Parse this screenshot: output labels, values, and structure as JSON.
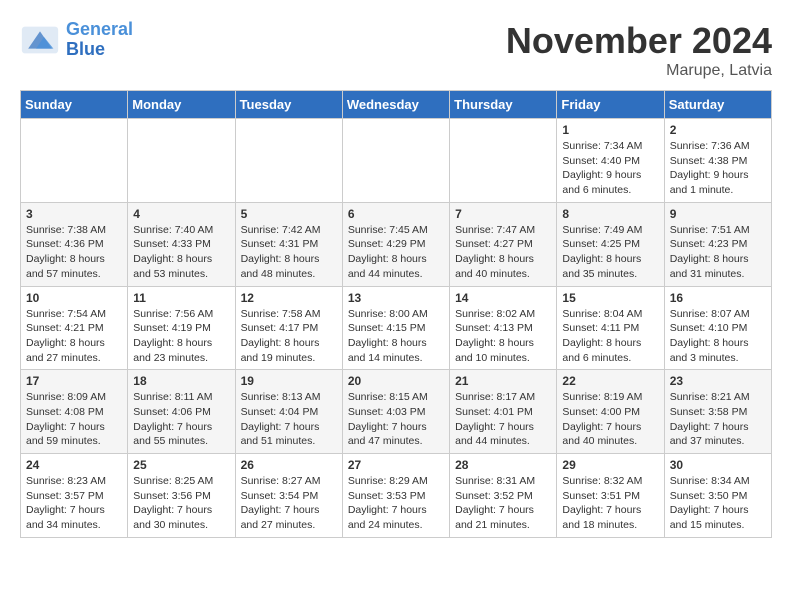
{
  "header": {
    "logo_line1": "General",
    "logo_line2": "Blue",
    "month": "November 2024",
    "location": "Marupe, Latvia"
  },
  "weekdays": [
    "Sunday",
    "Monday",
    "Tuesday",
    "Wednesday",
    "Thursday",
    "Friday",
    "Saturday"
  ],
  "weeks": [
    [
      {
        "day": "",
        "info": ""
      },
      {
        "day": "",
        "info": ""
      },
      {
        "day": "",
        "info": ""
      },
      {
        "day": "",
        "info": ""
      },
      {
        "day": "",
        "info": ""
      },
      {
        "day": "1",
        "info": "Sunrise: 7:34 AM\nSunset: 4:40 PM\nDaylight: 9 hours and 6 minutes."
      },
      {
        "day": "2",
        "info": "Sunrise: 7:36 AM\nSunset: 4:38 PM\nDaylight: 9 hours and 1 minute."
      }
    ],
    [
      {
        "day": "3",
        "info": "Sunrise: 7:38 AM\nSunset: 4:36 PM\nDaylight: 8 hours and 57 minutes."
      },
      {
        "day": "4",
        "info": "Sunrise: 7:40 AM\nSunset: 4:33 PM\nDaylight: 8 hours and 53 minutes."
      },
      {
        "day": "5",
        "info": "Sunrise: 7:42 AM\nSunset: 4:31 PM\nDaylight: 8 hours and 48 minutes."
      },
      {
        "day": "6",
        "info": "Sunrise: 7:45 AM\nSunset: 4:29 PM\nDaylight: 8 hours and 44 minutes."
      },
      {
        "day": "7",
        "info": "Sunrise: 7:47 AM\nSunset: 4:27 PM\nDaylight: 8 hours and 40 minutes."
      },
      {
        "day": "8",
        "info": "Sunrise: 7:49 AM\nSunset: 4:25 PM\nDaylight: 8 hours and 35 minutes."
      },
      {
        "day": "9",
        "info": "Sunrise: 7:51 AM\nSunset: 4:23 PM\nDaylight: 8 hours and 31 minutes."
      }
    ],
    [
      {
        "day": "10",
        "info": "Sunrise: 7:54 AM\nSunset: 4:21 PM\nDaylight: 8 hours and 27 minutes."
      },
      {
        "day": "11",
        "info": "Sunrise: 7:56 AM\nSunset: 4:19 PM\nDaylight: 8 hours and 23 minutes."
      },
      {
        "day": "12",
        "info": "Sunrise: 7:58 AM\nSunset: 4:17 PM\nDaylight: 8 hours and 19 minutes."
      },
      {
        "day": "13",
        "info": "Sunrise: 8:00 AM\nSunset: 4:15 PM\nDaylight: 8 hours and 14 minutes."
      },
      {
        "day": "14",
        "info": "Sunrise: 8:02 AM\nSunset: 4:13 PM\nDaylight: 8 hours and 10 minutes."
      },
      {
        "day": "15",
        "info": "Sunrise: 8:04 AM\nSunset: 4:11 PM\nDaylight: 8 hours and 6 minutes."
      },
      {
        "day": "16",
        "info": "Sunrise: 8:07 AM\nSunset: 4:10 PM\nDaylight: 8 hours and 3 minutes."
      }
    ],
    [
      {
        "day": "17",
        "info": "Sunrise: 8:09 AM\nSunset: 4:08 PM\nDaylight: 7 hours and 59 minutes."
      },
      {
        "day": "18",
        "info": "Sunrise: 8:11 AM\nSunset: 4:06 PM\nDaylight: 7 hours and 55 minutes."
      },
      {
        "day": "19",
        "info": "Sunrise: 8:13 AM\nSunset: 4:04 PM\nDaylight: 7 hours and 51 minutes."
      },
      {
        "day": "20",
        "info": "Sunrise: 8:15 AM\nSunset: 4:03 PM\nDaylight: 7 hours and 47 minutes."
      },
      {
        "day": "21",
        "info": "Sunrise: 8:17 AM\nSunset: 4:01 PM\nDaylight: 7 hours and 44 minutes."
      },
      {
        "day": "22",
        "info": "Sunrise: 8:19 AM\nSunset: 4:00 PM\nDaylight: 7 hours and 40 minutes."
      },
      {
        "day": "23",
        "info": "Sunrise: 8:21 AM\nSunset: 3:58 PM\nDaylight: 7 hours and 37 minutes."
      }
    ],
    [
      {
        "day": "24",
        "info": "Sunrise: 8:23 AM\nSunset: 3:57 PM\nDaylight: 7 hours and 34 minutes."
      },
      {
        "day": "25",
        "info": "Sunrise: 8:25 AM\nSunset: 3:56 PM\nDaylight: 7 hours and 30 minutes."
      },
      {
        "day": "26",
        "info": "Sunrise: 8:27 AM\nSunset: 3:54 PM\nDaylight: 7 hours and 27 minutes."
      },
      {
        "day": "27",
        "info": "Sunrise: 8:29 AM\nSunset: 3:53 PM\nDaylight: 7 hours and 24 minutes."
      },
      {
        "day": "28",
        "info": "Sunrise: 8:31 AM\nSunset: 3:52 PM\nDaylight: 7 hours and 21 minutes."
      },
      {
        "day": "29",
        "info": "Sunrise: 8:32 AM\nSunset: 3:51 PM\nDaylight: 7 hours and 18 minutes."
      },
      {
        "day": "30",
        "info": "Sunrise: 8:34 AM\nSunset: 3:50 PM\nDaylight: 7 hours and 15 minutes."
      }
    ]
  ]
}
